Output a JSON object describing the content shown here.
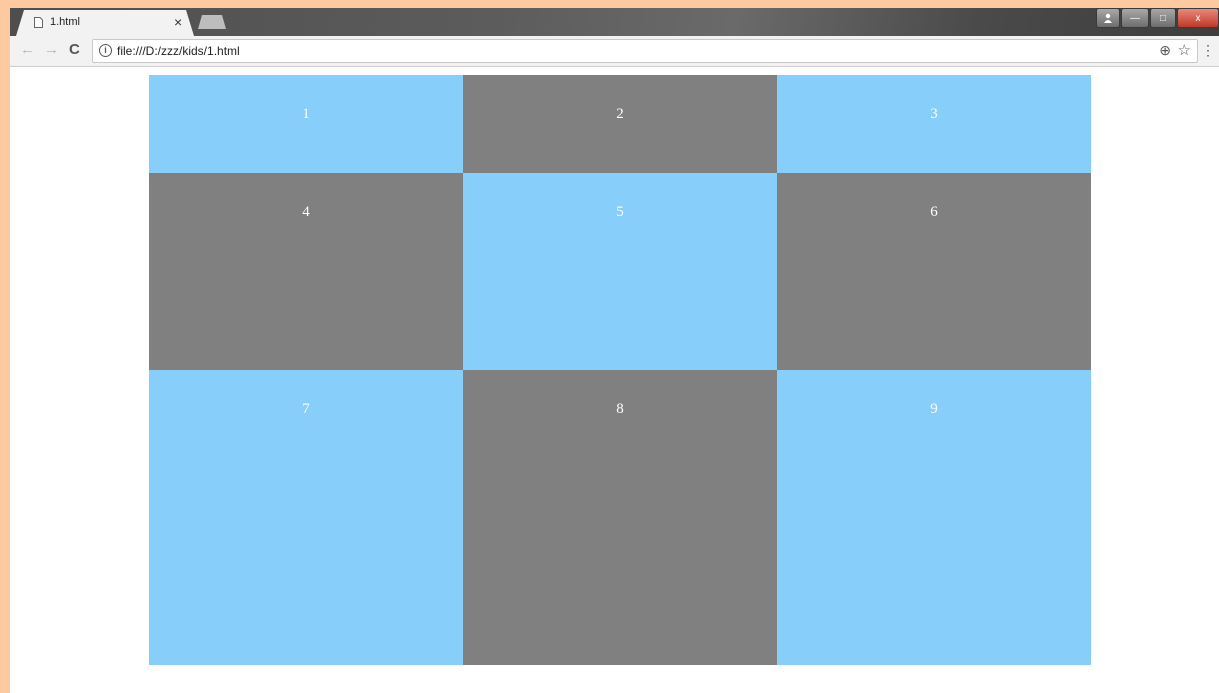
{
  "browser": {
    "tab_title": "1.html",
    "tab_close": "×",
    "url": "file:///D:/zzz/kids/1.html",
    "back_glyph": "←",
    "forward_glyph": "→",
    "reload_glyph": "C",
    "info_glyph": "i",
    "zoom_glyph": "⊕",
    "star_glyph": "☆",
    "menu_glyph": "⋮",
    "window_buttons": {
      "minimize": "—",
      "maximize": "□",
      "close": "x"
    }
  },
  "page": {
    "cells": [
      {
        "label": "1",
        "color": "#87cefa"
      },
      {
        "label": "2",
        "color": "#808080"
      },
      {
        "label": "3",
        "color": "#87cefa"
      },
      {
        "label": "4",
        "color": "#808080"
      },
      {
        "label": "5",
        "color": "#87cefa"
      },
      {
        "label": "6",
        "color": "#808080"
      },
      {
        "label": "7",
        "color": "#87cefa"
      },
      {
        "label": "8",
        "color": "#808080"
      },
      {
        "label": "9",
        "color": "#87cefa"
      }
    ]
  },
  "colors": {
    "light_blue": "#87cefa",
    "gray": "#808080",
    "desktop": "#fcc9a0"
  }
}
